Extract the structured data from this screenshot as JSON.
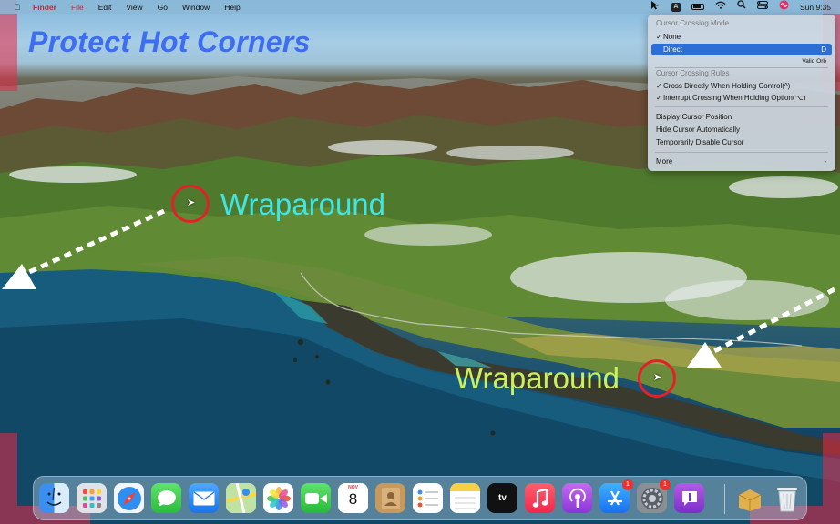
{
  "menubar": {
    "apple_icon": "apple-icon",
    "items": [
      "Finder",
      "File",
      "Edit",
      "View",
      "Go",
      "Window",
      "Help"
    ],
    "status_icons": [
      "crossing-mode-icon",
      "input-source-icon",
      "battery-icon",
      "wifi-icon",
      "search-icon",
      "control-center-icon",
      "siri-icon"
    ],
    "input_source_label": "A",
    "clock": "Sun 9:35"
  },
  "overlay": {
    "title": "Protect Hot Corners",
    "wraparound_top": "Wraparound",
    "wraparound_bottom": "Wraparound",
    "corner_color": "#eb2846",
    "title_color": "#3d6df0"
  },
  "dropdown": {
    "section1_header": "Cursor Crossing Mode",
    "none_label": "None",
    "direct_label": "Direct",
    "direct_shortcut": "D",
    "valid_label": "Valid Orb",
    "section2_header": "Cursor Crossing Rules",
    "rule1": "Cross Directly When Holding Control(^)",
    "rule2": "Interrupt Crossing When Holding Option(⌥)",
    "display_position": "Display Cursor Position",
    "hide_cursor": "Hide Cursor Automatically",
    "temp_disable": "Temporarily Disable Cursor",
    "more": "More",
    "check": "✓",
    "chevron": "›"
  },
  "dock": {
    "calendar_month": "NOV",
    "calendar_day": "8",
    "tv_label": "tv",
    "appstore_badge": "1",
    "settings_badge": "1",
    "icons": [
      "finder-icon",
      "launchpad-icon",
      "safari-icon",
      "messages-icon",
      "mail-icon",
      "maps-icon",
      "photos-icon",
      "facetime-icon",
      "calendar-icon",
      "contacts-icon",
      "reminders-icon",
      "notes-icon",
      "apple-tv-icon",
      "music-icon",
      "podcasts-icon",
      "app-store-icon",
      "system-preferences-icon",
      "feedback-icon",
      "archive-icon",
      "trash-icon"
    ]
  }
}
